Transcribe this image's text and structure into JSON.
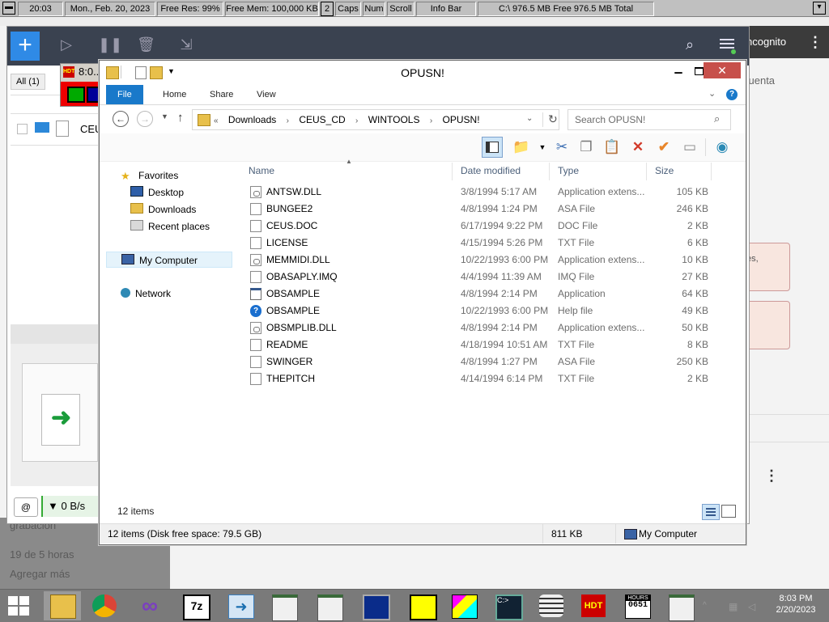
{
  "infobar": {
    "time": "20:03",
    "date": "Mon., Feb. 20, 2023",
    "free_res": "Free Res: 99%",
    "free_mem": "Free Mem: 100,000 KB",
    "count": "2",
    "caps": "Caps",
    "num": "Num",
    "scroll": "Scroll",
    "info_bar": "Info Bar",
    "disk": "C:\\ 976.5 MB Free  976.5 MB Total"
  },
  "background": {
    "incognito": "ncognito",
    "cuenta": "cuenta",
    "es": "es,",
    "lower_lines": [
      "grabación",
      "19 de 5 horas",
      "Agregar más"
    ]
  },
  "app": {
    "filter": "All (1)",
    "list_name": "CEU",
    "speed": "0 B/s"
  },
  "hdt": {
    "time": "8:0..",
    "logo": "HDT"
  },
  "explorer": {
    "title": "OPUSN!",
    "ribbon_tabs": [
      "File",
      "Home",
      "Share",
      "View"
    ],
    "breadcrumb": [
      "Downloads",
      "CEUS_CD",
      "WINTOOLS",
      "OPUSN!"
    ],
    "breadcrumb_prefix": "«",
    "search_placeholder": "Search OPUSN!",
    "nav": {
      "favorites": "Favorites",
      "desktop": "Desktop",
      "downloads": "Downloads",
      "recent": "Recent places",
      "mycomputer": "My Computer",
      "network": "Network"
    },
    "columns": [
      "Name",
      "Date modified",
      "Type",
      "Size"
    ],
    "files": [
      {
        "name": "ANTSW.DLL",
        "date": "3/8/1994 5:17 AM",
        "type": "Application extens...",
        "size": "105 KB",
        "icon": "dll-icon"
      },
      {
        "name": "BUNGEE2",
        "date": "4/8/1994 1:24 PM",
        "type": "ASA File",
        "size": "246 KB",
        "icon": "generic-file-icon"
      },
      {
        "name": "CEUS.DOC",
        "date": "6/17/1994 9:22 PM",
        "type": "DOC File",
        "size": "2 KB",
        "icon": "generic-file-icon"
      },
      {
        "name": "LICENSE",
        "date": "4/15/1994 5:26 PM",
        "type": "TXT File",
        "size": "6 KB",
        "icon": "generic-file-icon"
      },
      {
        "name": "MEMMIDI.DLL",
        "date": "10/22/1993 6:00 PM",
        "type": "Application extens...",
        "size": "10 KB",
        "icon": "dll-icon"
      },
      {
        "name": "OBASAPLY.IMQ",
        "date": "4/4/1994 11:39 AM",
        "type": "IMQ File",
        "size": "27 KB",
        "icon": "generic-file-icon"
      },
      {
        "name": "OBSAMPLE",
        "date": "4/8/1994 2:14 PM",
        "type": "Application",
        "size": "64 KB",
        "icon": "application-icon"
      },
      {
        "name": "OBSAMPLE",
        "date": "10/22/1993 6:00 PM",
        "type": "Help file",
        "size": "49 KB",
        "icon": "help-icon"
      },
      {
        "name": "OBSMPLIB.DLL",
        "date": "4/8/1994 2:14 PM",
        "type": "Application extens...",
        "size": "50 KB",
        "icon": "dll-icon"
      },
      {
        "name": "README",
        "date": "4/18/1994 10:51 AM",
        "type": "TXT File",
        "size": "8 KB",
        "icon": "generic-file-icon"
      },
      {
        "name": "SWINGER",
        "date": "4/8/1994 1:27 PM",
        "type": "ASA File",
        "size": "250 KB",
        "icon": "generic-file-icon"
      },
      {
        "name": "THEPITCH",
        "date": "4/14/1994 6:14 PM",
        "type": "TXT File",
        "size": "2 KB",
        "icon": "generic-file-icon"
      }
    ],
    "item_count": "12 items",
    "status": {
      "items_free": "12 items (Disk free space: 79.5 GB)",
      "size": "811 KB",
      "location": "My Computer"
    }
  },
  "taskbar": {
    "clock_time": "8:03 PM",
    "clock_date": "2/20/2023",
    "hours_label": "HOURS",
    "hours_value": "0651",
    "hdt_label": "HDT"
  }
}
